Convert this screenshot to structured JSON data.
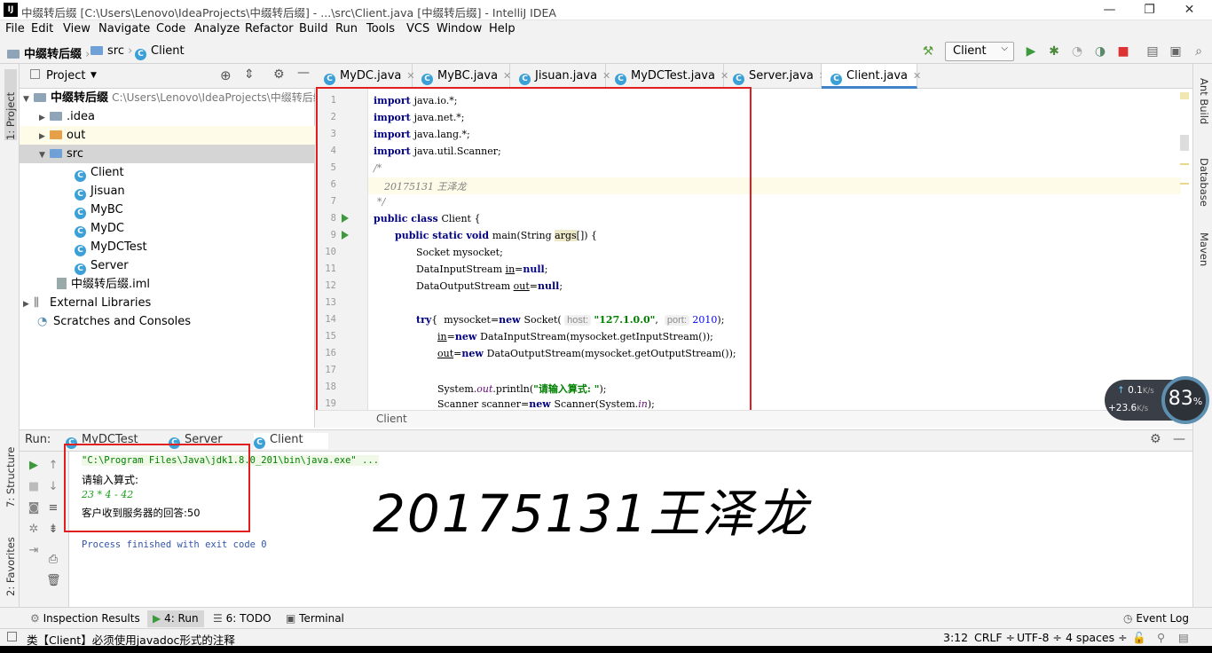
{
  "titlebar": {
    "title": "中缀转后缀 [C:\\Users\\Lenovo\\IdeaProjects\\中缀转后缀] - ...\\src\\Client.java [中缀转后缀] - IntelliJ IDEA",
    "app_icon": "IJ"
  },
  "menu": [
    "File",
    "Edit",
    "View",
    "Navigate",
    "Code",
    "Analyze",
    "Refactor",
    "Build",
    "Run",
    "Tools",
    "VCS",
    "Window",
    "Help"
  ],
  "navbar": {
    "crumbs": [
      "中缀转后缀",
      "src",
      "Client"
    ],
    "run_config": "Client"
  },
  "left_strip": {
    "project_tab": "1: Project",
    "structure_tab": "7: Structure",
    "favorites_tab": "2: Favorites"
  },
  "right_strip": {
    "ant": "Ant Build",
    "database": "Database",
    "maven": "Maven"
  },
  "project": {
    "header": "Project",
    "root": {
      "name": "中缀转后缀",
      "path": "C:\\Users\\Lenovo\\IdeaProjects\\中缀转后缀"
    },
    "items": [
      ".idea",
      "out",
      "src",
      "Client",
      "Jisuan",
      "MyBC",
      "MyDC",
      "MyDCTest",
      "Server",
      "中缀转后缀.iml",
      "External Libraries",
      "Scratches and Consoles"
    ]
  },
  "editor": {
    "tabs": [
      "MyDC.java",
      "MyBC.java",
      "Jisuan.java",
      "MyDCTest.java",
      "Server.java",
      "Client.java"
    ],
    "active_tab": "Client.java",
    "line_numbers": [
      "1",
      "2",
      "3",
      "4",
      "5",
      "6",
      "7",
      "8",
      "9",
      "10",
      "11",
      "12",
      "13",
      "14",
      "15",
      "16",
      "17",
      "18",
      "19"
    ],
    "breadcrumb": "Client",
    "hint_host": "host:",
    "hint_port": "port:",
    "lines": {
      "l1": "java.io.*;",
      "l2": "java.net.*;",
      "l3": "java.lang.*;",
      "l4": "java.util.Scanner;",
      "l5": "/*",
      "l6": "20175131 王泽龙",
      "l7": "*/",
      "l10": "Socket mysocket;",
      "l11a": "DataInputStream ",
      "l11b": "in",
      "l11c": "=",
      "l11d": "null",
      "l12a": "DataOutputStream ",
      "l12b": "out",
      "l12c": "=",
      "l12d": "null",
      "l14str": "\"127.1.0.0\"",
      "l14num": "2010",
      "l18str": "\"请输入算式: \""
    }
  },
  "run": {
    "label": "Run:",
    "tabs": [
      "MyDCTest",
      "Server",
      "Client"
    ],
    "console": {
      "cmd": "\"C:\\Program Files\\Java\\jdk1.8.0_201\\bin\\java.exe\" ...",
      "prompt": "请输入算式:",
      "input": "23 * 4 - 42",
      "answer": "客户收到服务器的回答:50",
      "exit": "Process finished with exit code 0"
    },
    "watermark": "20175131王泽龙"
  },
  "bottom_tabs": [
    "Inspection Results",
    "4: Run",
    "6: TODO",
    "Terminal",
    "Event Log"
  ],
  "status": {
    "message": "类【Client】必须使用javadoc形式的注释",
    "position": "3:12",
    "line_sep": "CRLF ÷",
    "encoding": "UTF-8 ÷",
    "indent": "4 spaces ÷"
  },
  "widget": {
    "up": "0.1",
    "down": "+23.6",
    "unit": "K/s",
    "percent": "83",
    "percent_sign": "%"
  }
}
